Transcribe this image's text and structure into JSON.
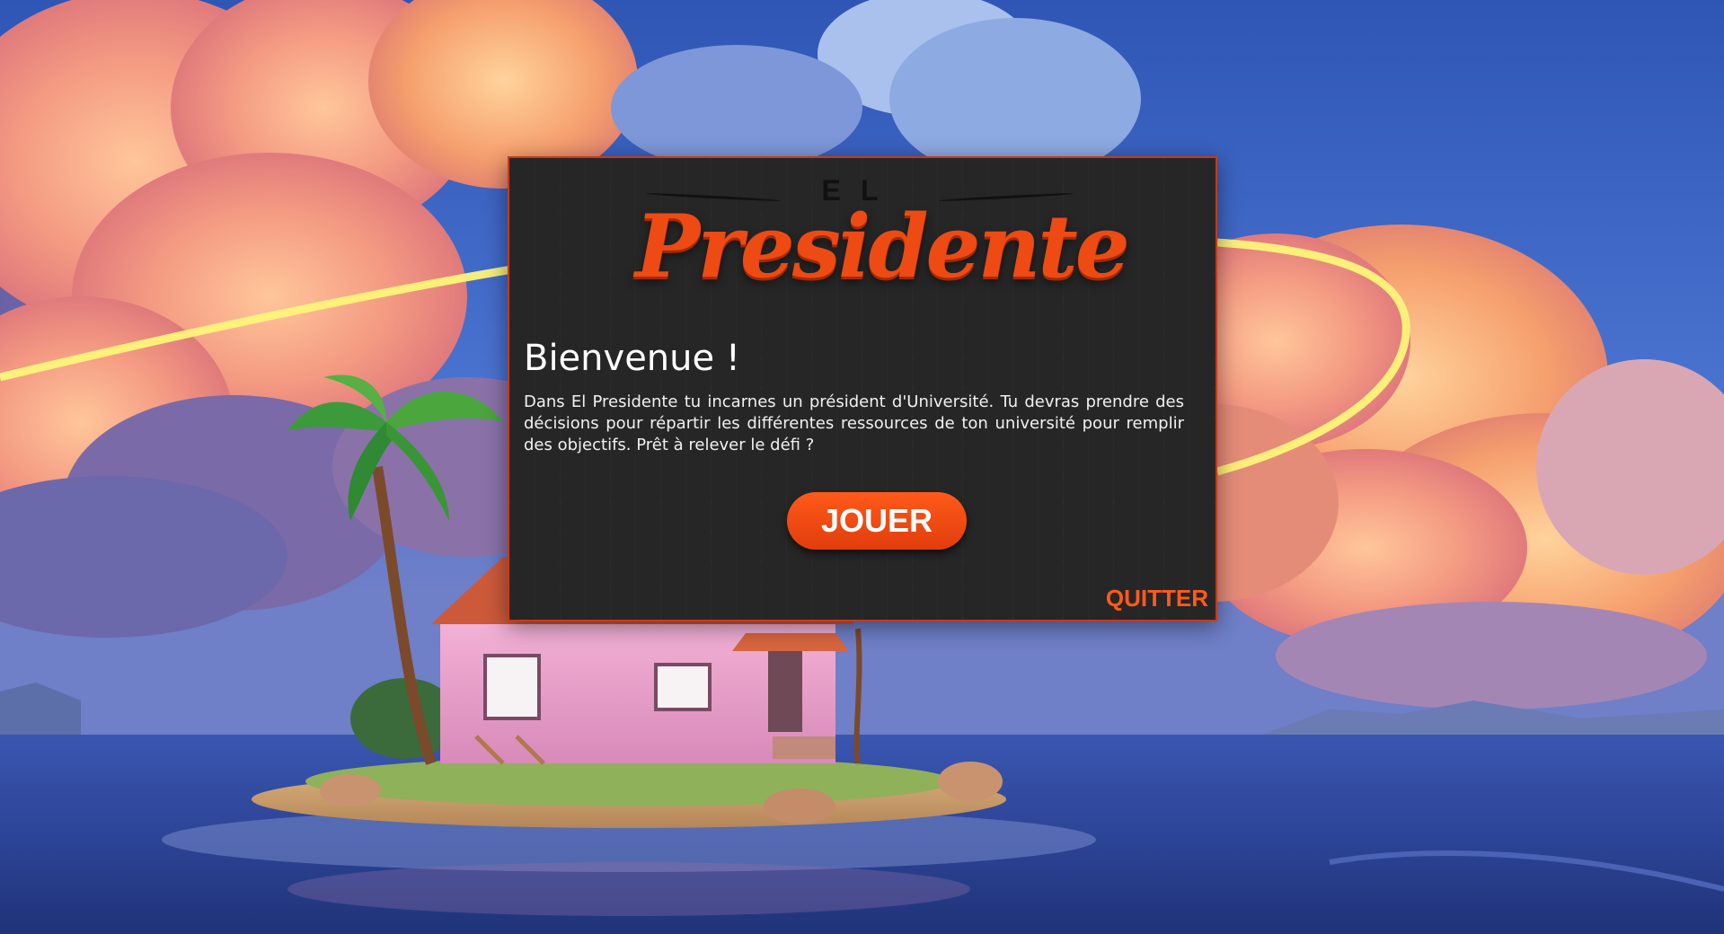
{
  "logo": {
    "prefix": "EL",
    "title": "Presidente"
  },
  "dialog": {
    "title": "Bienvenue !",
    "text": "Dans El Presidente tu incarnes un président d'Université. Tu devras prendre des décisions pour répartir les différentes ressources de ton université pour remplir des objectifs. Prêt à relever le défi ?",
    "play_label": "JOUER",
    "quit_label": "QUITTER"
  },
  "colors": {
    "accent": "#ff5a1a",
    "panel_background": "#262626",
    "panel_border": "#c8391a"
  }
}
